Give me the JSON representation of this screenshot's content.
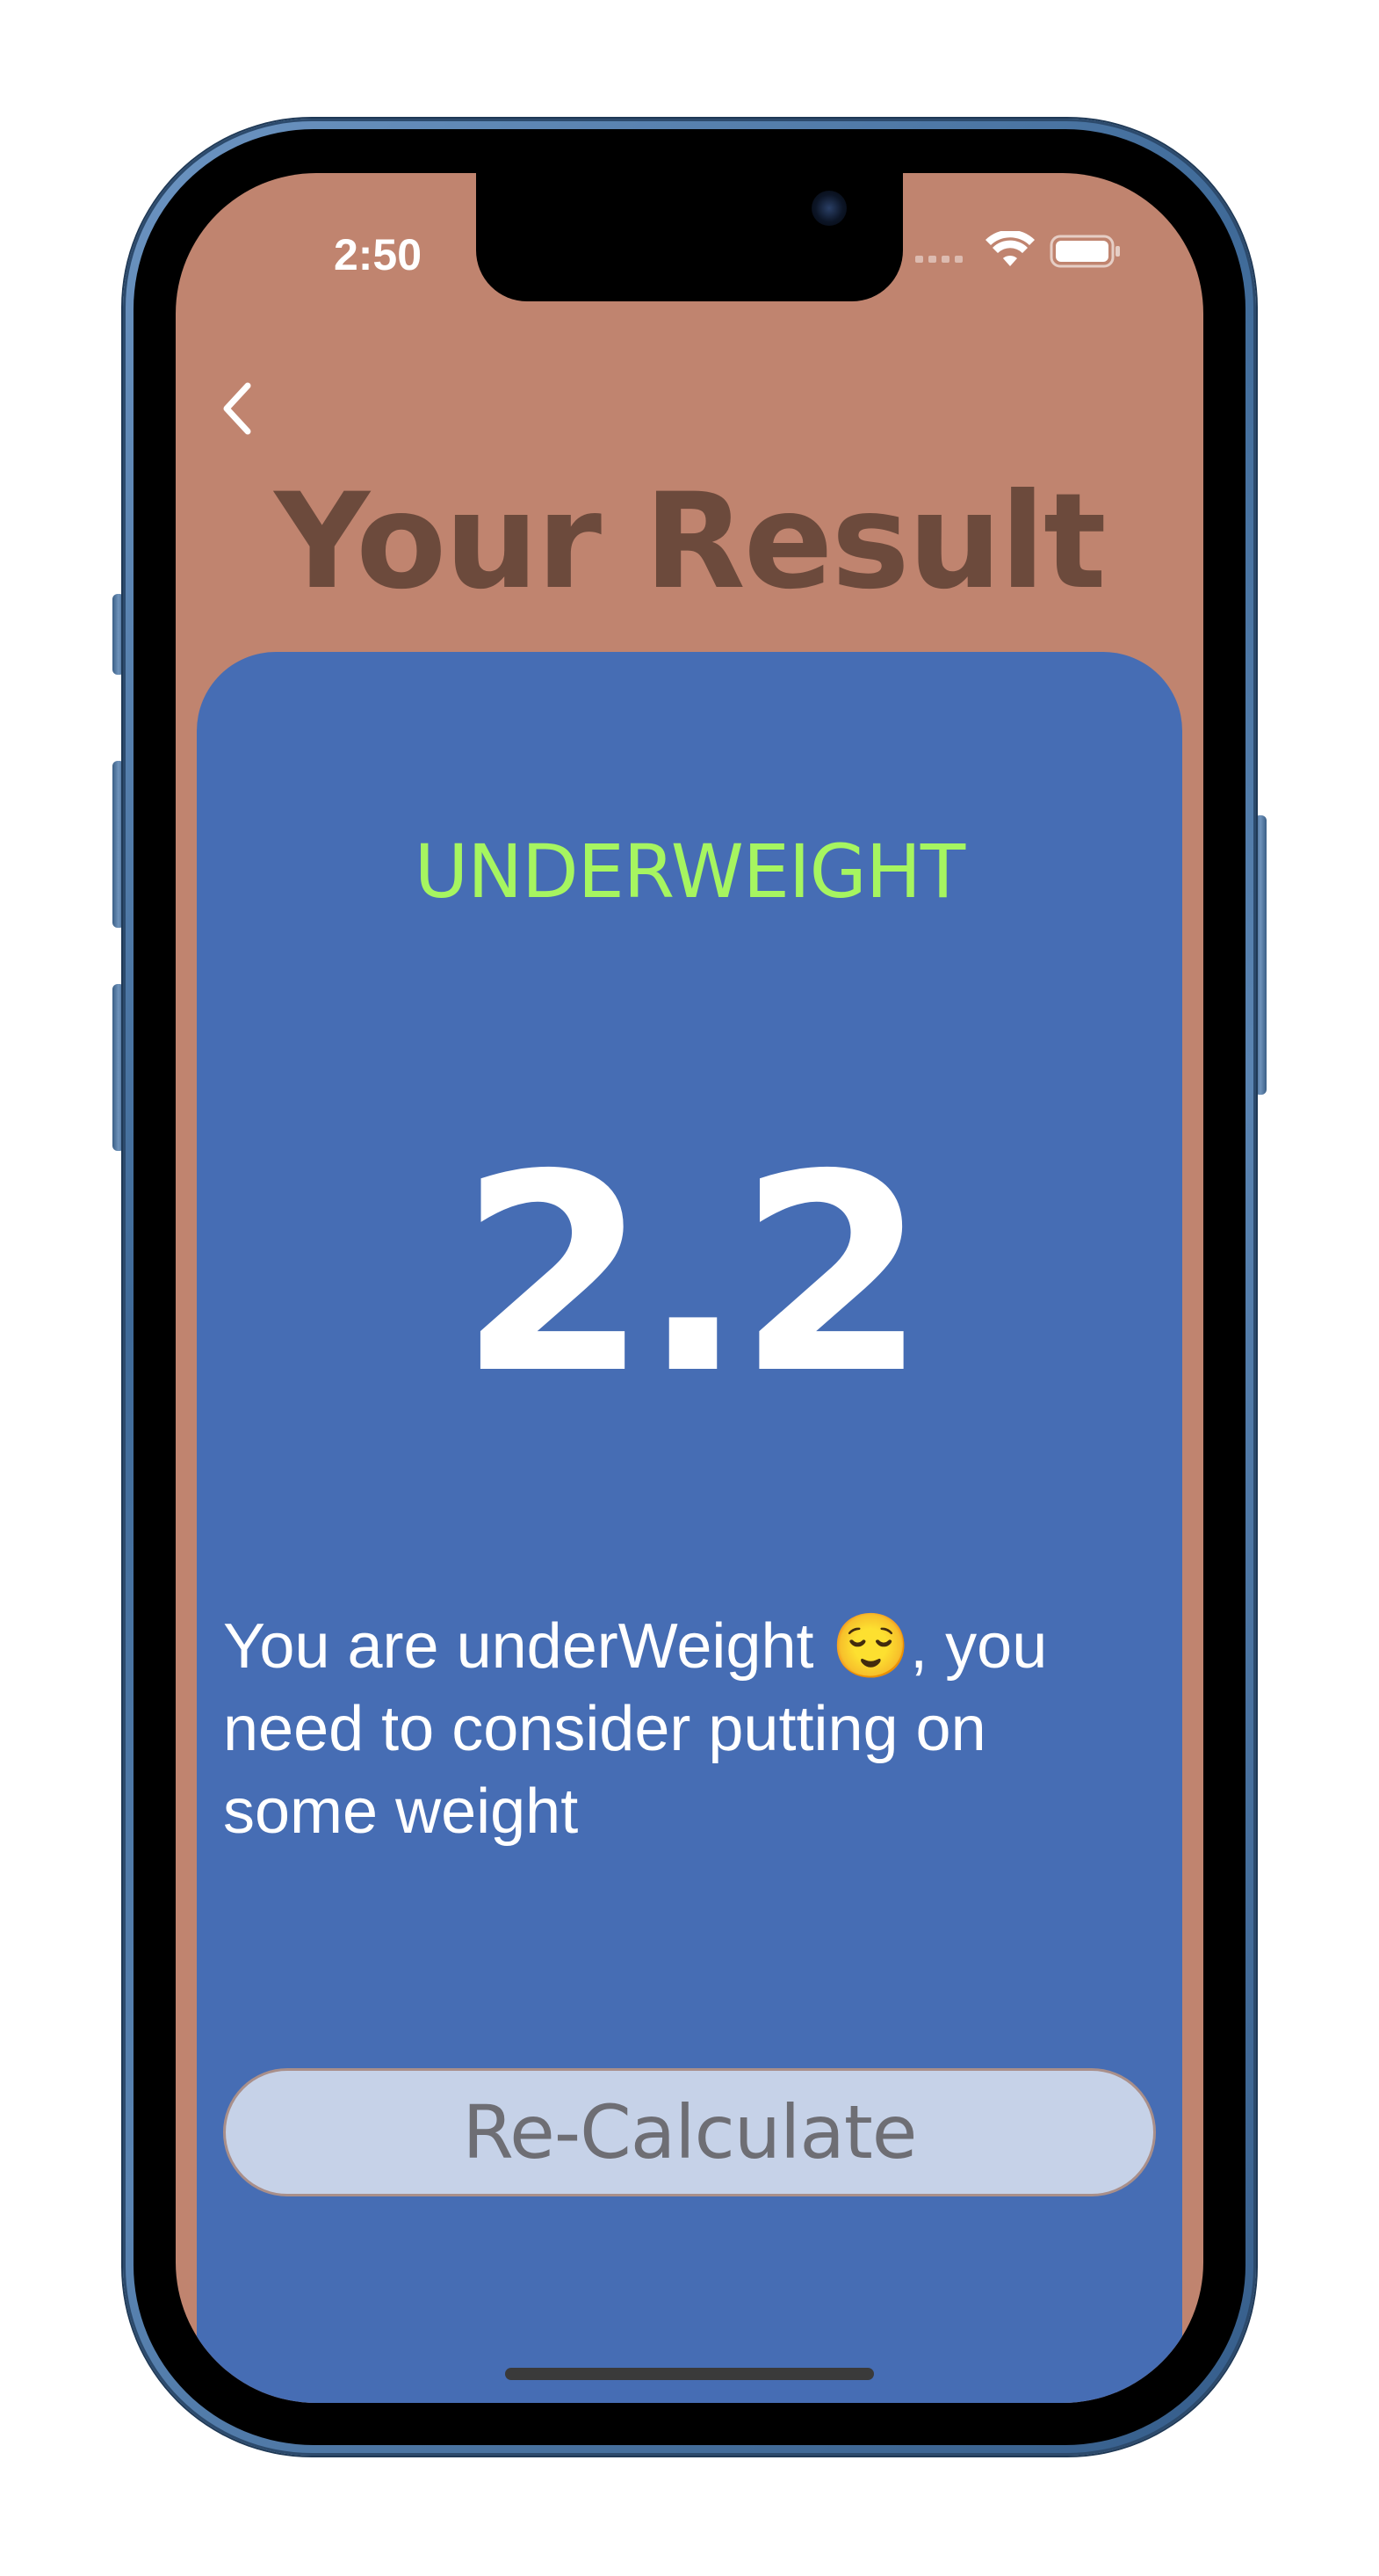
{
  "status_bar": {
    "time": "2:50",
    "icons": [
      "cellular-signal-icon",
      "wifi-icon",
      "battery-icon"
    ]
  },
  "nav": {
    "back_icon": "chevron-left-icon"
  },
  "title": "Your Result",
  "result": {
    "status": "UNDERWEIGHT",
    "bmi": "2.2",
    "message": "You are underWeight 😌, you need to consider putting on some weight"
  },
  "actions": {
    "recalculate_label": "Re-Calculate"
  },
  "colors": {
    "background": "#c0846f",
    "title": "#6c4a3c",
    "card": "#466db4",
    "status": "#a6f560",
    "button": "#c6d2e8",
    "button_text": "#6e6e74"
  }
}
